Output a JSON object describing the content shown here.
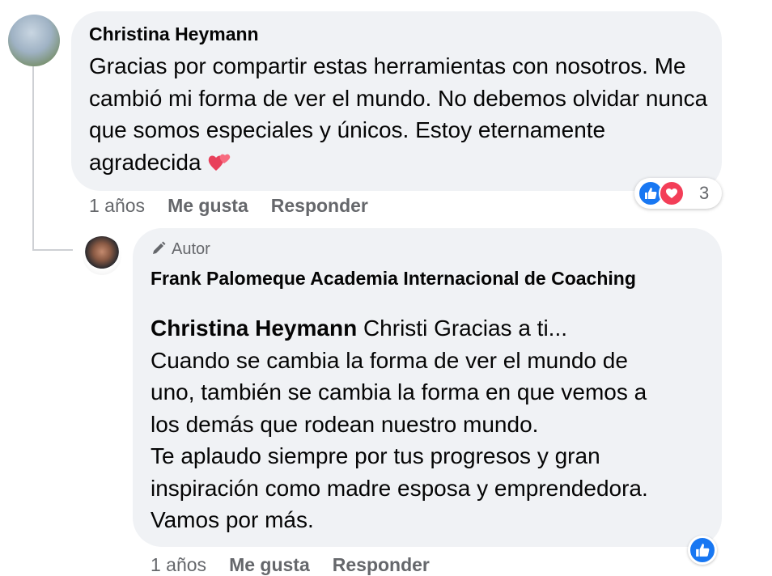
{
  "comment": {
    "author": "Christina Heymann",
    "text": "Gracias por compartir estas herramientas con nosotros. Me cambió mi forma de ver el mundo. No debemos olvidar nunca que somos especiales y únicos. Estoy eternamente agradecida",
    "emoji": "two-hearts-icon",
    "time": "1 años",
    "like_label": "Me gusta",
    "reply_label": "Responder",
    "reactions": {
      "types": [
        "like-icon",
        "love-icon"
      ],
      "count": "3"
    }
  },
  "reply": {
    "badge_label": "Autor",
    "author": "Frank Palomeque Academia Internacional de Coaching",
    "mention": "Christina Heymann",
    "first_line_rest": " Christi Gracias a ti...",
    "body_lines": [
      "Cuando se cambia la forma de ver el mundo de",
      "uno, también se cambia la forma en que vemos a",
      "los demás que rodean nuestro mundo.",
      "Te aplaudo siempre por tus progresos y gran",
      "inspiración como madre esposa y emprendedora.",
      "Vamos por más."
    ],
    "time": "1 años",
    "like_label": "Me gusta",
    "reply_label": "Responder",
    "reactions": {
      "types": [
        "like-icon"
      ]
    }
  },
  "colors": {
    "bubble": "#f0f2f5",
    "meta_text": "#65676b",
    "like_blue": "#1877f2",
    "love_red": "#f33e58",
    "thread_line": "#ced0d4"
  }
}
